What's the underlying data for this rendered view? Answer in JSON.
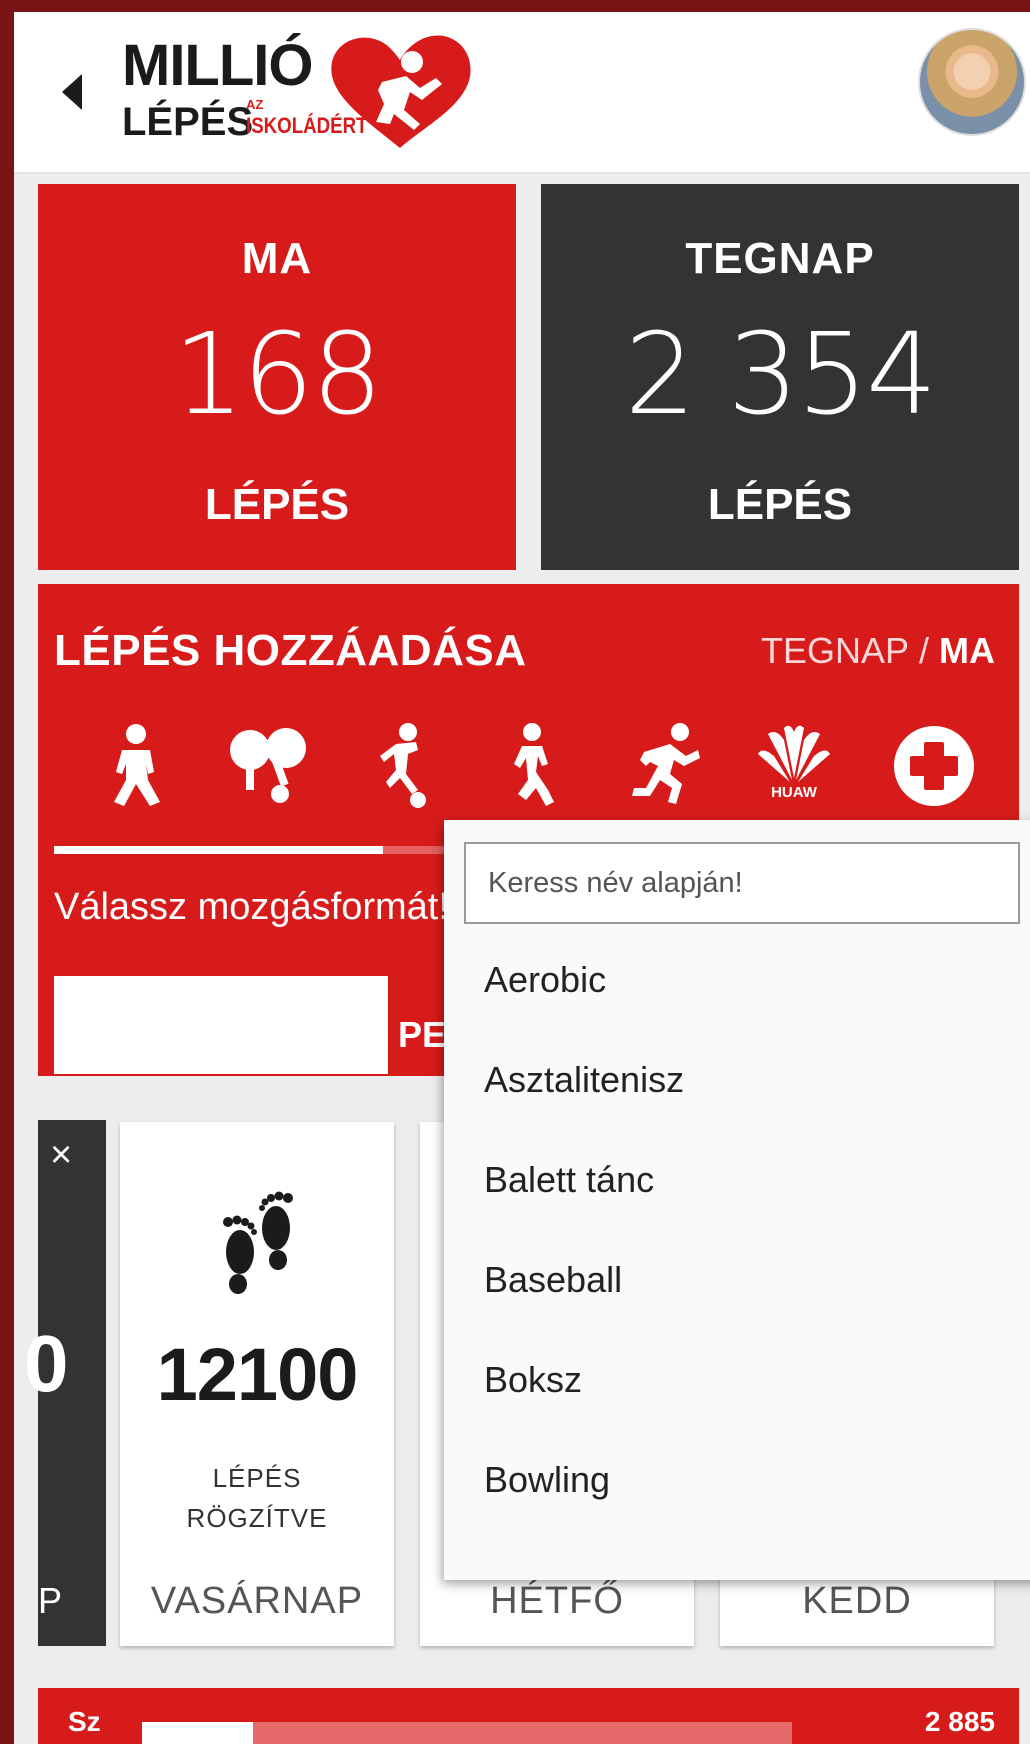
{
  "header": {
    "logo": {
      "line1": "MILLIÓ",
      "line2": "LÉPÉS",
      "az": "AZ",
      "iskoladert": "ISKOLÁDÉRT"
    },
    "back_icon": "chevron-left-icon",
    "avatar_icon": "user-avatar"
  },
  "stats": {
    "today": {
      "label": "MA",
      "value": "168",
      "unit": "LÉPÉS"
    },
    "yesterday": {
      "label": "TEGNAP",
      "value": "2 354",
      "unit": "LÉPÉS"
    }
  },
  "add_steps": {
    "title": "LÉPÉS HOZZÁADÁSA",
    "toggle_yesterday": "TEGNAP",
    "toggle_sep": " / ",
    "toggle_today": "MA",
    "activities": [
      "walking-icon",
      "table-tennis-icon",
      "soccer-icon",
      "running-icon",
      "sprint-icon",
      "huawei-icon"
    ],
    "huawei_label": "HUAW",
    "choose_label": "Válassz mozgásformát!",
    "submit_partial": "PE",
    "progress": 0.35
  },
  "dropdown": {
    "placeholder": "Keress név alapján!",
    "options": [
      "Aerobic",
      "Asztalitenisz",
      "Balett tánc",
      "Baseball",
      "Boksz",
      "Bowling"
    ]
  },
  "day_cards": {
    "partial": {
      "close": "×",
      "value": "0",
      "day": "P"
    },
    "cards": [
      {
        "value": "12100",
        "sub1": "LÉPÉS",
        "sub2": "RÖGZÍTVE",
        "day": "VASÁRNAP"
      },
      {
        "day": "HÉTFŐ"
      },
      {
        "day": "KEDD"
      }
    ]
  },
  "bottom_bar": {
    "label": "Sz",
    "value": "2 885",
    "progress": 0.17
  },
  "colors": {
    "accent": "#d71b1b",
    "dark": "#333333",
    "frame": "#7a1414"
  }
}
